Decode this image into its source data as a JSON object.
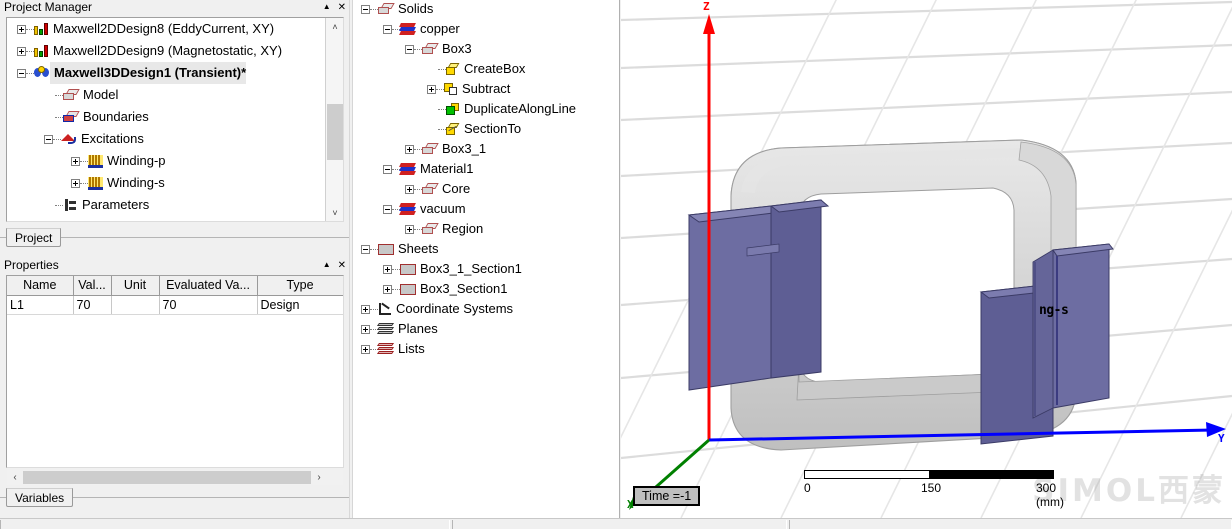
{
  "app": {
    "status_bar_segments": [
      "",
      "",
      ""
    ]
  },
  "project_manager": {
    "title": "Project Manager",
    "collapse_icon": "collapse-caret-icon",
    "close_icon": "close-icon",
    "tab": "Project",
    "scroll_up_glyph": "˄",
    "scroll_down_glyph": "˅",
    "tree": [
      {
        "label": "Maxwell2DDesign8 (EddyCurrent, XY)",
        "icon": "design-2d-icon",
        "expander": "plus",
        "depth": 0,
        "selected": false
      },
      {
        "label": "Maxwell2DDesign9 (Magnetostatic, XY)",
        "icon": "design-2d-icon",
        "expander": "plus",
        "depth": 0,
        "selected": false
      },
      {
        "label": "Maxwell3DDesign1 (Transient)*",
        "icon": "design-3d-icon",
        "expander": "minus",
        "depth": 0,
        "selected": true
      },
      {
        "label": "Model",
        "icon": "model-box-icon",
        "expander": "none",
        "depth": 1,
        "selected": false
      },
      {
        "label": "Boundaries",
        "icon": "boundaries-icon",
        "expander": "none",
        "depth": 1,
        "selected": false
      },
      {
        "label": "Excitations",
        "icon": "excitations-icon",
        "expander": "minus",
        "depth": 1,
        "selected": false
      },
      {
        "label": "Winding-p",
        "icon": "winding-icon",
        "expander": "plus",
        "depth": 2,
        "selected": false
      },
      {
        "label": "Winding-s",
        "icon": "winding-icon",
        "expander": "plus",
        "depth": 2,
        "selected": false
      },
      {
        "label": "Parameters",
        "icon": "parameters-icon",
        "expander": "none",
        "depth": 1,
        "selected": false
      }
    ]
  },
  "properties": {
    "title": "Properties",
    "collapse_icon": "collapse-caret-icon",
    "close_icon": "close-icon",
    "tab": "Variables",
    "columns": [
      "Name",
      "Val...",
      "Unit",
      "Evaluated Va...",
      "Type"
    ],
    "rows": [
      [
        "L1",
        "70",
        "",
        "70",
        "Design"
      ]
    ],
    "hscroll_left_glyph": "‹",
    "hscroll_right_glyph": "›"
  },
  "model_tree": {
    "items": [
      {
        "label": "Solids",
        "icon": "solids-icon",
        "expander": "minus",
        "depth": 0
      },
      {
        "label": "copper",
        "icon": "material-stack-icon",
        "expander": "minus",
        "depth": 1
      },
      {
        "label": "Box3",
        "icon": "solid-box-icon",
        "expander": "minus",
        "depth": 2
      },
      {
        "label": "CreateBox",
        "icon": "create-box-icon",
        "expander": "none",
        "depth": 3
      },
      {
        "label": "Subtract",
        "icon": "subtract-icon",
        "expander": "plus",
        "depth": 3
      },
      {
        "label": "DuplicateAlongLine",
        "icon": "duplicate-along-line-icon",
        "expander": "none",
        "depth": 3
      },
      {
        "label": "SectionTo",
        "icon": "section-to-icon",
        "expander": "none",
        "depth": 3
      },
      {
        "label": "Box3_1",
        "icon": "solid-box-icon",
        "expander": "plus",
        "depth": 2
      },
      {
        "label": "Material1",
        "icon": "material-stack-icon",
        "expander": "minus",
        "depth": 1
      },
      {
        "label": "Core",
        "icon": "solid-box-icon",
        "expander": "plus",
        "depth": 2
      },
      {
        "label": "vacuum",
        "icon": "material-stack-icon",
        "expander": "minus",
        "depth": 1
      },
      {
        "label": "Region",
        "icon": "solid-box-icon",
        "expander": "plus",
        "depth": 2
      },
      {
        "label": "Sheets",
        "icon": "sheet-icon",
        "expander": "minus",
        "depth": 0
      },
      {
        "label": "Box3_1_Section1",
        "icon": "sheet-icon",
        "expander": "plus",
        "depth": 1
      },
      {
        "label": "Box3_Section1",
        "icon": "sheet-icon",
        "expander": "plus",
        "depth": 1
      },
      {
        "label": "Coordinate Systems",
        "icon": "coordinate-systems-icon",
        "expander": "plus",
        "depth": 0
      },
      {
        "label": "Planes",
        "icon": "planes-icon",
        "expander": "plus",
        "depth": 0
      },
      {
        "label": "Lists",
        "icon": "lists-icon",
        "expander": "plus",
        "depth": 0
      }
    ]
  },
  "viewport": {
    "axes": {
      "x": "X",
      "y": "Y",
      "z": "Z"
    },
    "axis_colors": {
      "x": "#008000",
      "y": "#0000ff",
      "z": "#ff0000"
    },
    "time_label": "Time =-1",
    "scale": {
      "ticks": [
        "0",
        "150",
        "300 (mm)"
      ]
    },
    "model_label": "ng-s",
    "model_colors": {
      "core": "#cfcfcf",
      "winding": "#6a6a9e"
    },
    "watermark": "SIMOL西蒙"
  }
}
